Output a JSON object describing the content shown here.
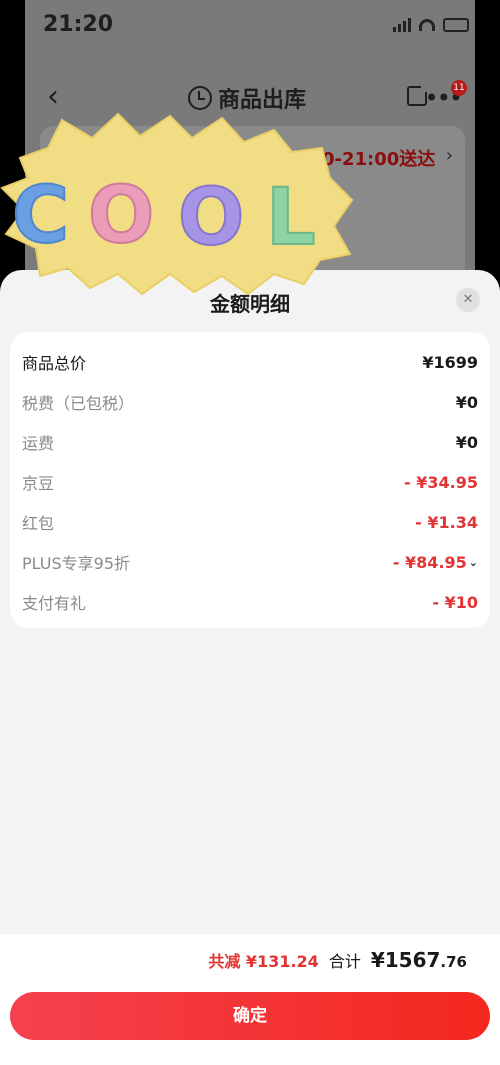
{
  "status_bar": {
    "time": "21:20"
  },
  "nav": {
    "back_glyph": "‹",
    "title": "商品出库",
    "title_icon": "clock-icon",
    "share_icon": "share-icon",
    "more_glyph": "•••",
    "badge_count": "11"
  },
  "background_card": {
    "delivery_text": "0-21:00送达",
    "chevron": "›"
  },
  "sticker": {
    "text": "COOL"
  },
  "sheet": {
    "title": "金额明细",
    "close_glyph": "✕",
    "rows": [
      {
        "label": "商品总价",
        "value": "¥1699"
      },
      {
        "label": "税费（已包税）",
        "value": "¥0"
      },
      {
        "label": "运费",
        "value": "¥0"
      },
      {
        "label": "京豆",
        "value": "- ¥34.95"
      },
      {
        "label": "红包",
        "value": "- ¥1.34"
      },
      {
        "label": "PLUS专享95折",
        "value": "- ¥84.95"
      },
      {
        "label": "支付有礼",
        "value": "- ¥10"
      }
    ]
  },
  "footer": {
    "saved": "共减 ¥131.24",
    "total_label": "合计",
    "total_main": "¥1567",
    "total_cents": ".76",
    "confirm_label": "确定"
  },
  "colors": {
    "accent_red": "#e23434",
    "button_gradient_start": "#f5414f",
    "button_gradient_end": "#f3271d",
    "sticker_yellow": "#f1dd84"
  }
}
